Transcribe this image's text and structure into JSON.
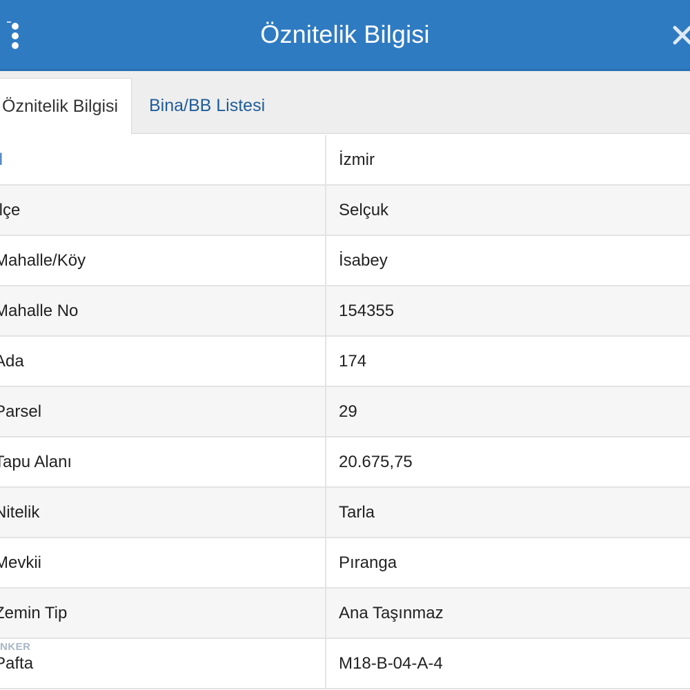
{
  "header": {
    "title": "Öznitelik Bilgisi"
  },
  "tabs": [
    {
      "label": "Öznitelik Bilgisi",
      "active": true
    },
    {
      "label": "Bina/BB Listesi",
      "active": false
    }
  ],
  "rows": [
    {
      "label": "İl",
      "value": "İzmir"
    },
    {
      "label": "İlçe",
      "value": "Selçuk"
    },
    {
      "label": "Mahalle/Köy",
      "value": "İsabey"
    },
    {
      "label": "Mahalle No",
      "value": "154355"
    },
    {
      "label": "Ada",
      "value": "174"
    },
    {
      "label": "Parsel",
      "value": "29"
    },
    {
      "label": "Tapu Alanı",
      "value": "20.675,75"
    },
    {
      "label": "Nitelik",
      "value": "Tarla"
    },
    {
      "label": "Mevkii",
      "value": "Pıranga"
    },
    {
      "label": "Zemin Tip",
      "value": "Ana Taşınmaz"
    },
    {
      "label": "Pafta",
      "value": "M18-B-04-A-4"
    }
  ],
  "watermark": "NKER",
  "colors": {
    "header_bg": "#2f7bc2",
    "tab_link": "#1f5c99",
    "row_alt": "#f6f6f6"
  },
  "icons": {
    "menu": "vertical-dots-icon",
    "close": "close-icon"
  }
}
